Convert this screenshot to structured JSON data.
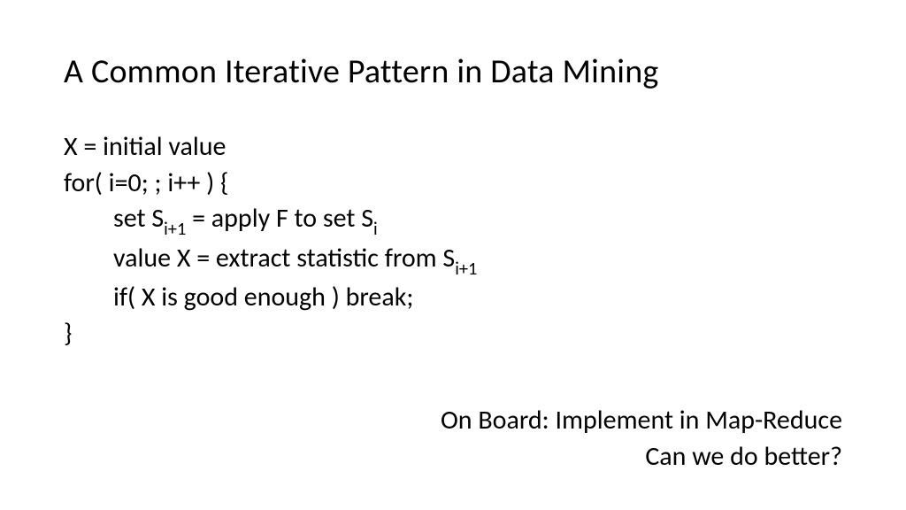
{
  "title": "A Common Iterative Pattern in Data Mining",
  "code": {
    "line1": "X = initial value",
    "line2": "for( i=0; ; i++ ) {",
    "line3_a": "set S",
    "line3_sub1": "i+1",
    "line3_b": " = apply F to set S",
    "line3_sub2": "i",
    "line4_a": "value X = extract statistic from S",
    "line4_sub1": "i+1",
    "line5": "if( X is good enough ) break;",
    "line6": " }"
  },
  "footer": {
    "line1": "On Board: Implement in Map-Reduce",
    "line2": "Can we do better?"
  }
}
